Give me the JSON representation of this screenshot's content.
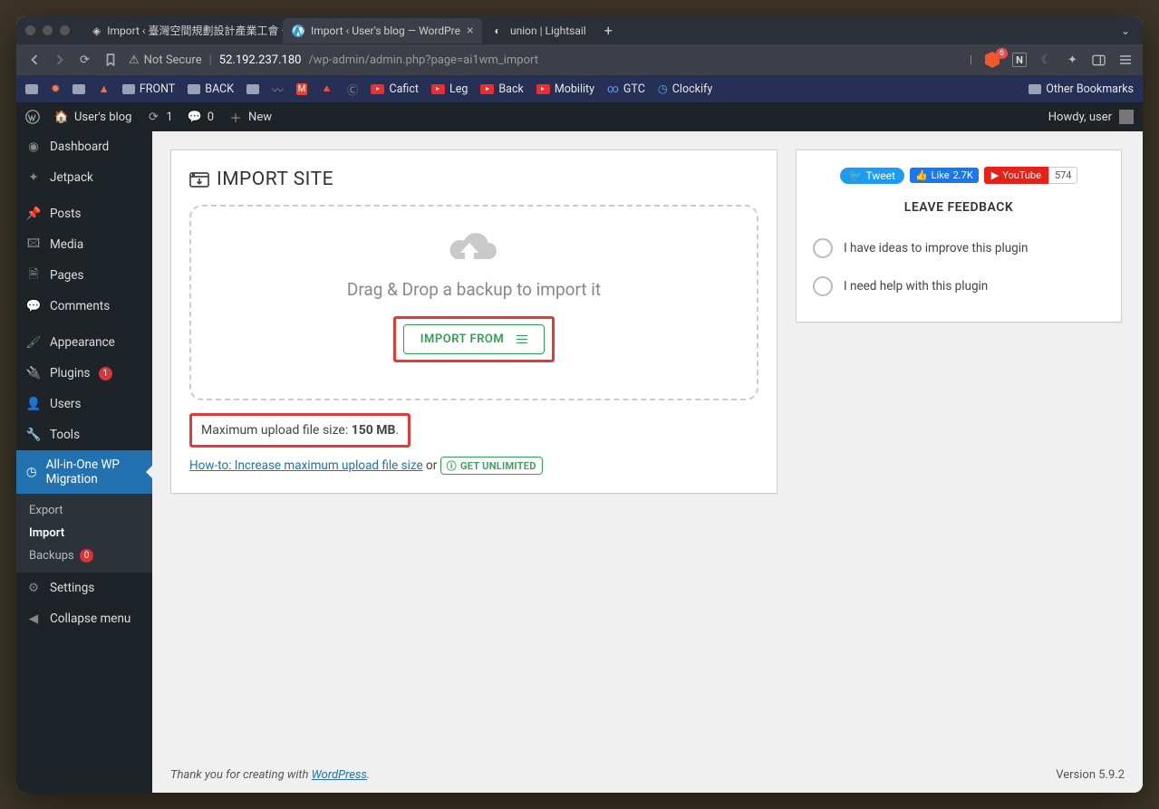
{
  "browser": {
    "tabs": [
      {
        "title": "Import ‹ 臺灣空間規劃設計產業工會 —"
      },
      {
        "title": "Import ‹ User's blog — WordPre",
        "active": true
      },
      {
        "title": "union | Lightsail"
      }
    ],
    "not_secure": "Not Secure",
    "url_host": "52.192.237.180",
    "url_path": "/wp-admin/admin.php?page=ai1wm_import",
    "brave_badge": "6",
    "bookmarks": {
      "front": "FRONT",
      "back": "BACK",
      "cafict": "Cafict",
      "leg": "Leg",
      "back2": "Back",
      "mobility": "Mobility",
      "gtc": "GTC",
      "clockify": "Clockify",
      "other": "Other Bookmarks"
    }
  },
  "adminbar": {
    "site": "User's blog",
    "updates": "1",
    "comments": "0",
    "new": "New",
    "howdy": "Howdy, user"
  },
  "sidebar": {
    "dashboard": "Dashboard",
    "jetpack": "Jetpack",
    "posts": "Posts",
    "media": "Media",
    "pages": "Pages",
    "comments": "Comments",
    "appearance": "Appearance",
    "plugins": "Plugins",
    "plugins_count": "1",
    "users": "Users",
    "tools": "Tools",
    "ai1wm": "All-in-One WP Migration",
    "export": "Export",
    "import": "Import",
    "backups": "Backups",
    "backups_count": "0",
    "settings": "Settings",
    "collapse": "Collapse menu"
  },
  "page": {
    "title": "IMPORT SITE",
    "drop_text": "Drag & Drop a backup to import it",
    "import_btn": "IMPORT FROM",
    "max_label": "Maximum upload file size: ",
    "max_value": "150 MB",
    "howto_link": "How-to: Increase maximum upload file size",
    "or": " or ",
    "unlimited": "GET UNLIMITED",
    "feedback_title": "LEAVE FEEDBACK",
    "fb1": "I have ideas to improve this plugin",
    "fb2": "I need help with this plugin",
    "tweet": "Tweet",
    "like": "Like",
    "like_count": "2.7K",
    "youtube": "YouTube",
    "yt_count": "574"
  },
  "footer": {
    "thanks": "Thank you for creating with ",
    "wp": "WordPress",
    "version": "Version 5.9.2"
  }
}
